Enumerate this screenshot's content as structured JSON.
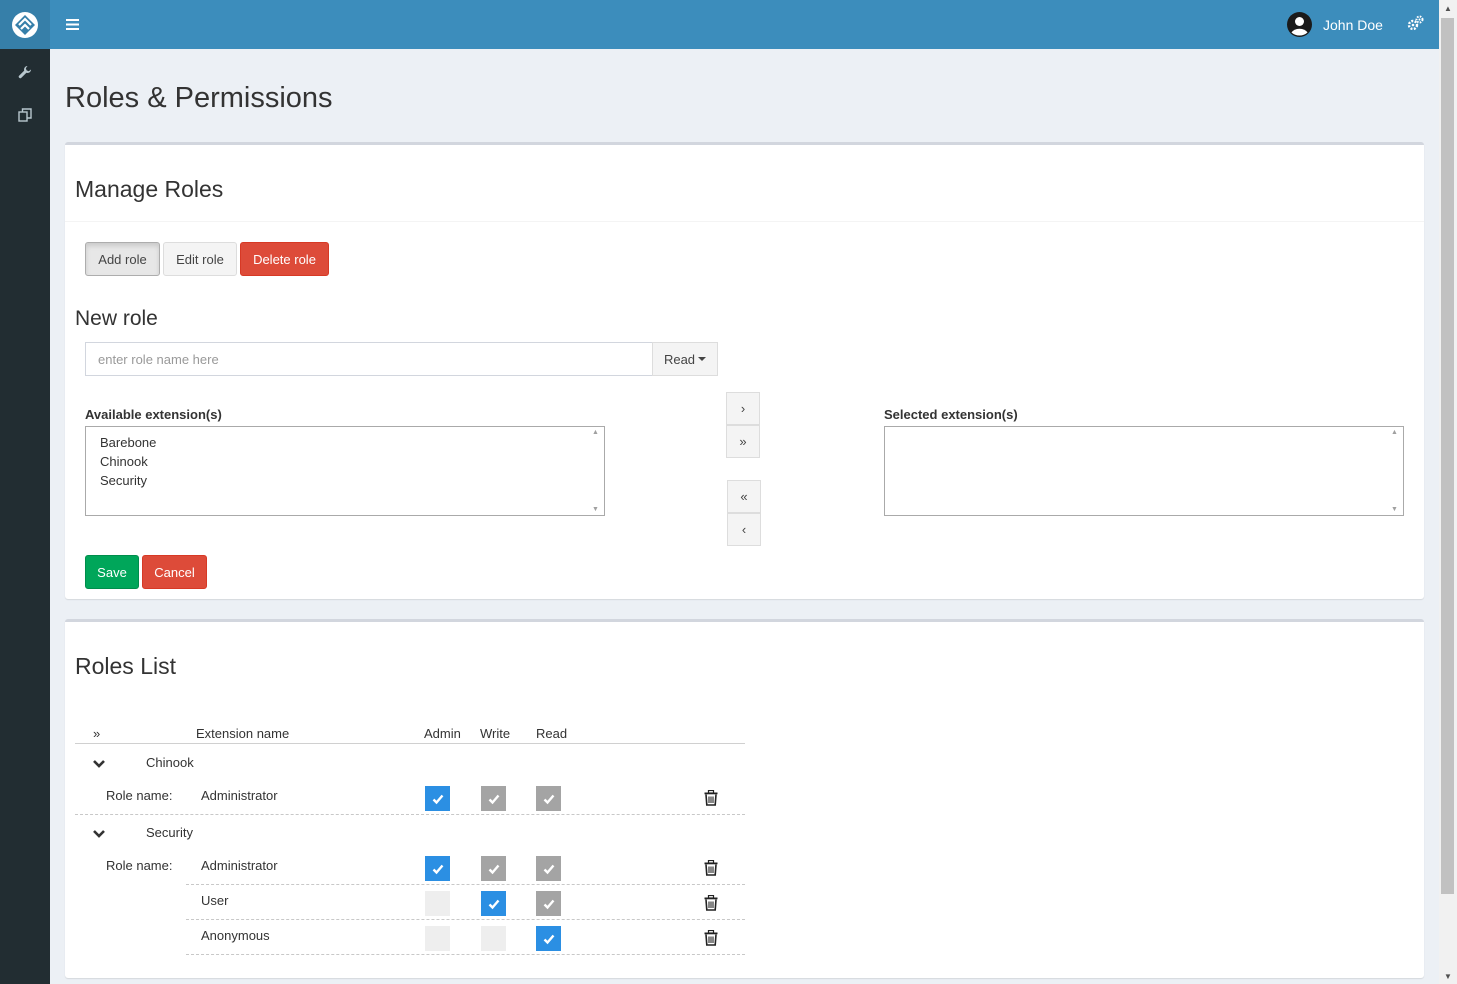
{
  "header": {
    "user_name": "John Doe"
  },
  "page": {
    "title": "Roles & Permissions"
  },
  "manage_roles": {
    "title": "Manage Roles",
    "buttons": {
      "add": "Add role",
      "edit": "Edit role",
      "delete": "Delete role"
    },
    "new_role": {
      "title": "New role",
      "placeholder": "enter role name here",
      "permission": "Read"
    },
    "available": {
      "label": "Available extension(s)",
      "items": [
        "Barebone",
        "Chinook",
        "Security"
      ]
    },
    "selected": {
      "label": "Selected extension(s)"
    },
    "transfer": {
      "move_one": "›",
      "move_all": "»",
      "remove_all": "«",
      "remove_one": "‹"
    },
    "save": "Save",
    "cancel": "Cancel"
  },
  "roles_list": {
    "title": "Roles List",
    "expand_all": "»",
    "columns": {
      "extension": "Extension name",
      "admin": "Admin",
      "write": "Write",
      "read": "Read"
    },
    "role_name_label": "Role name:",
    "groups": [
      {
        "name": "Chinook",
        "roles": [
          {
            "name": "Administrator",
            "admin": "checked",
            "write": "implied",
            "read": "implied"
          }
        ]
      },
      {
        "name": "Security",
        "roles": [
          {
            "name": "Administrator",
            "admin": "checked",
            "write": "implied",
            "read": "implied"
          },
          {
            "name": "User",
            "admin": "unchecked",
            "write": "checked",
            "read": "implied"
          },
          {
            "name": "Anonymous",
            "admin": "unchecked",
            "write": "unchecked",
            "read": "checked"
          }
        ]
      }
    ]
  },
  "colors": {
    "header": "#3c8dbc",
    "logo_bg": "#367fa9",
    "sidebar": "#222d32",
    "danger": "#dd4b39",
    "success": "#00a65a",
    "checkbox_checked": "#2b8fe3",
    "checkbox_implied": "#a4a4a4"
  },
  "icons": [
    "logo-icon",
    "wrench-icon",
    "copy-icon",
    "hamburger-icon",
    "user-avatar-icon",
    "gears-icon",
    "chevron-down-icon",
    "trash-icon",
    "check-icon"
  ]
}
